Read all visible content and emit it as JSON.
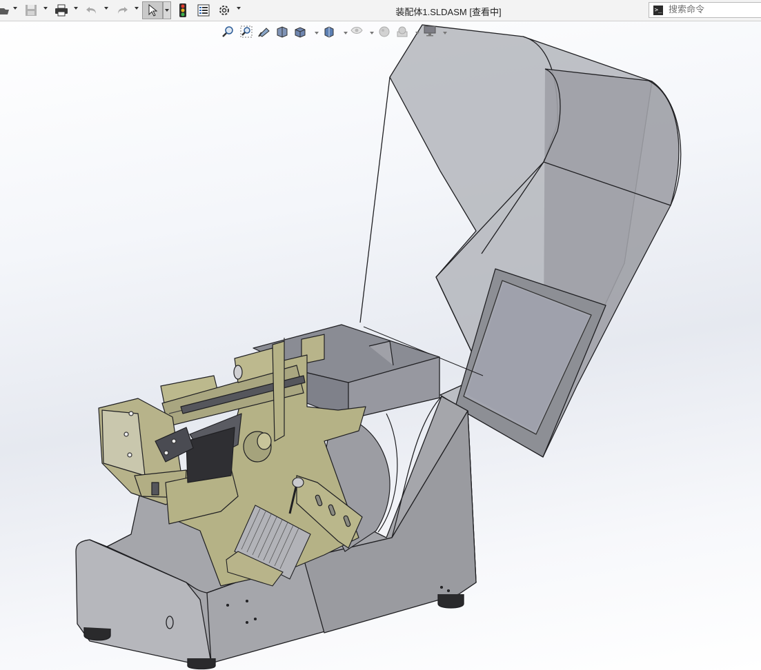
{
  "window": {
    "title": "装配体1.SLDASM [查看中]"
  },
  "toolbar": {
    "items": [
      {
        "name": "open",
        "icon": "folder-open-icon"
      },
      {
        "name": "save",
        "icon": "save-icon"
      },
      {
        "name": "print",
        "icon": "print-icon"
      },
      {
        "name": "undo",
        "icon": "undo-icon"
      },
      {
        "name": "redo",
        "icon": "redo-icon"
      },
      {
        "name": "select",
        "icon": "cursor-select-icon"
      },
      {
        "name": "rebuild",
        "icon": "traffic-light-icon"
      },
      {
        "name": "file-properties",
        "icon": "file-properties-icon"
      },
      {
        "name": "options",
        "icon": "gear-icon"
      }
    ]
  },
  "search": {
    "placeholder": "搜索命令",
    "icon": "command-prompt-icon"
  },
  "view_toolbar": {
    "items": [
      {
        "name": "zoom-to-fit",
        "icon": "zoom-fit-icon"
      },
      {
        "name": "zoom-to-area",
        "icon": "zoom-area-icon"
      },
      {
        "name": "previous-view",
        "icon": "previous-view-icon"
      },
      {
        "name": "section-view",
        "icon": "section-view-icon"
      },
      {
        "name": "view-orientation",
        "icon": "view-orientation-icon"
      },
      {
        "name": "display-style",
        "icon": "display-style-icon"
      },
      {
        "name": "hide-show-items",
        "icon": "eye-icon"
      },
      {
        "name": "edit-appearance",
        "icon": "appearance-icon"
      },
      {
        "name": "apply-scene",
        "icon": "scene-icon"
      },
      {
        "name": "view-settings",
        "icon": "monitor-icon"
      }
    ]
  },
  "colors": {
    "titlebar": "#f3f3f3",
    "cover": "#a9abb1",
    "body": "#a7a8ad",
    "bracket": "#b8b48a",
    "dark_part": "#3c3c40",
    "edge": "#1f1f22"
  }
}
